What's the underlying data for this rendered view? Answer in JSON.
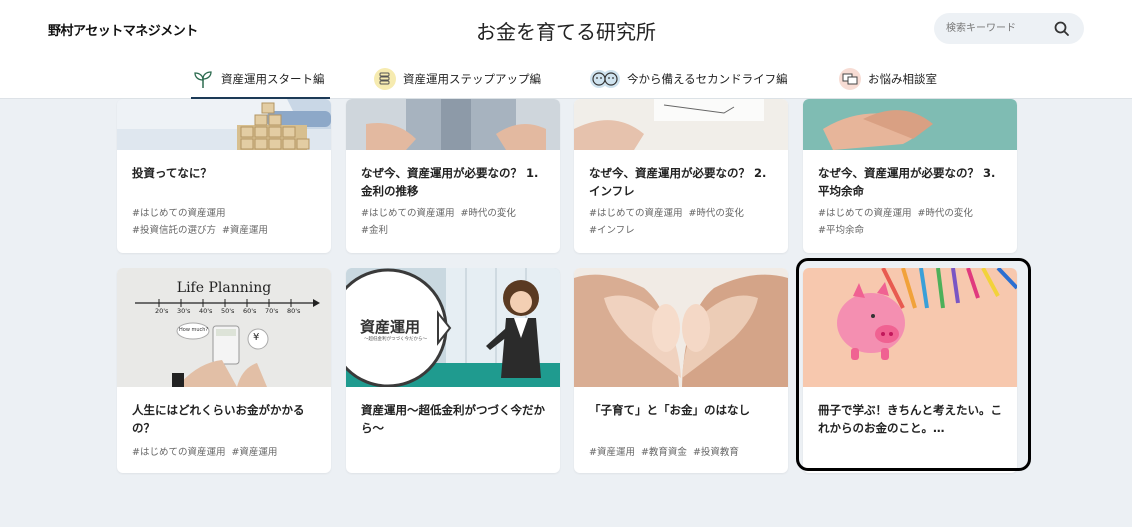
{
  "header": {
    "logo": "野村アセットマネジメント",
    "site_title": "お金を育てる研究所",
    "search": {
      "placeholder": "検索キーワード"
    }
  },
  "nav": {
    "items": [
      {
        "label": "資産運用スタート編",
        "icon": "sprout-icon"
      },
      {
        "label": "資産運用ステップアップ編",
        "icon": "coin-stack-icon"
      },
      {
        "label": "今から備えるセカンドライフ編",
        "icon": "couple-icon"
      },
      {
        "label": "お悩み相談室",
        "icon": "chat-icon"
      }
    ]
  },
  "cards_row1": [
    {
      "title": "投資ってなに？",
      "tags": [
        "#はじめての資産運用",
        "#投資信託の選び方",
        "#資産運用"
      ]
    },
    {
      "title": "なぜ今、資産運用が必要なの？ 1. 金利の推移",
      "tags": [
        "#はじめての資産運用",
        "#時代の変化",
        "#金利"
      ]
    },
    {
      "title": "なぜ今、資産運用が必要なの？ 2. インフレ",
      "tags": [
        "#はじめての資産運用",
        "#時代の変化",
        "#インフレ"
      ]
    },
    {
      "title": "なぜ今、資産運用が必要なの？ 3. 平均余命",
      "tags": [
        "#はじめての資産運用",
        "#時代の変化",
        "#平均余命"
      ]
    }
  ],
  "cards_row2": [
    {
      "title": "人生にはどれくらいお金がかかるの？",
      "tags": [
        "#はじめての資産運用",
        "#資産運用"
      ],
      "thumb_text": "Life Planning",
      "thumb_ages": [
        "20's",
        "30's",
        "40's",
        "50's",
        "60's",
        "70's",
        "80's"
      ],
      "thumb_bubble": "How much?",
      "thumb_coin": "¥"
    },
    {
      "title": "資産運用～超低金利がつづく今だから～",
      "tags": [],
      "thumb_text": "資産運用",
      "thumb_sub": "～超低金利がつづく今だから～"
    },
    {
      "title": "「子育て」と「お金」のはなし",
      "tags": [
        "#資産運用",
        "#教育資金",
        "#投資教育"
      ]
    },
    {
      "title": "冊子で学ぶ！きちんと考えたい。これからのお金のこと。…",
      "tags": []
    }
  ]
}
